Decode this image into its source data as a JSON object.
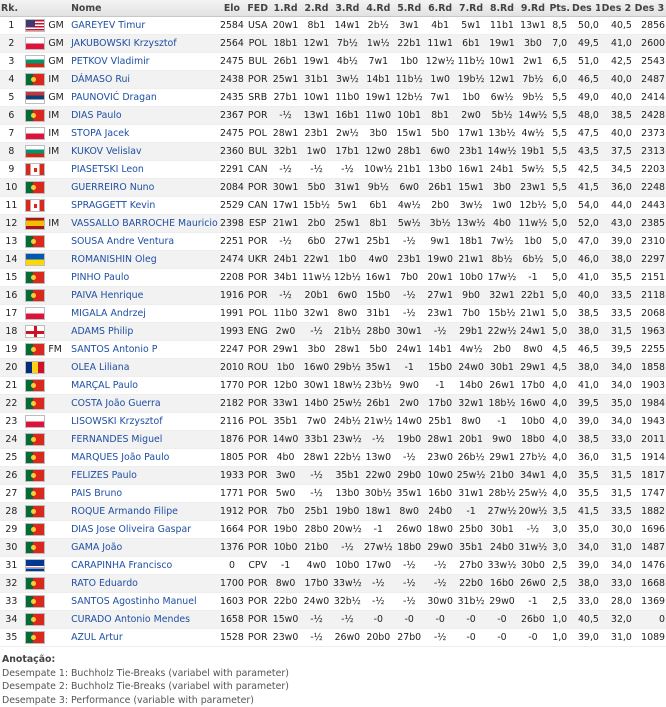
{
  "headers": {
    "rank": "Rk.",
    "title": "",
    "name": "Nome",
    "elo": "Elo",
    "fed": "FED",
    "rounds": [
      "1.Rd",
      "2.Rd",
      "3.Rd",
      "4.Rd",
      "5.Rd",
      "6.Rd",
      "7.Rd",
      "8.Rd",
      "9.Rd"
    ],
    "pts": "Pts.",
    "des1": "Des 1",
    "des2": "Des 2",
    "des3": "Des 3"
  },
  "rows": [
    {
      "rk": "1",
      "title": "GM",
      "name": "GAREYEV Timur",
      "elo": "2584",
      "fed": "USA",
      "flag": "usa",
      "rounds": [
        "20w1",
        "8b1",
        "14w1",
        "2b½",
        "3w1",
        "4b1",
        "5w1",
        "11b1",
        "13w1"
      ],
      "pts": "8,5",
      "des1": "50,0",
      "des2": "40,5",
      "des3": "2856"
    },
    {
      "rk": "2",
      "title": "GM",
      "name": "JAKUBOWSKI Krzysztof",
      "elo": "2564",
      "fed": "POL",
      "flag": "pol",
      "rounds": [
        "18b1",
        "12w1",
        "7b½",
        "1w½",
        "22b1",
        "11w1",
        "6b1",
        "19w1",
        "3b0"
      ],
      "pts": "7,0",
      "des1": "49,5",
      "des2": "41,0",
      "des3": "2600"
    },
    {
      "rk": "3",
      "title": "GM",
      "name": "PETKOV Vladimir",
      "elo": "2475",
      "fed": "BUL",
      "flag": "bul",
      "rounds": [
        "26b1",
        "19w1",
        "4b½",
        "7w1",
        "1b0",
        "12w½",
        "11b½",
        "10w1",
        "2w1"
      ],
      "pts": "6,5",
      "des1": "51,0",
      "des2": "42,5",
      "des3": "2543"
    },
    {
      "rk": "4",
      "title": "IM",
      "name": "DÁMASO Rui",
      "elo": "2438",
      "fed": "POR",
      "flag": "por",
      "rounds": [
        "25w1",
        "31b1",
        "3w½",
        "14b1",
        "11b½",
        "1w0",
        "19b½",
        "12w1",
        "7b½"
      ],
      "pts": "6,0",
      "des1": "46,5",
      "des2": "40,0",
      "des3": "2487"
    },
    {
      "rk": "5",
      "title": "GM",
      "name": "PAUNOVIĆ Dragan",
      "elo": "2435",
      "fed": "SRB",
      "flag": "srb",
      "rounds": [
        "27b1",
        "10w1",
        "11b0",
        "19w1",
        "12b½",
        "7w1",
        "1b0",
        "6w½",
        "9b½"
      ],
      "pts": "5,5",
      "des1": "49,0",
      "des2": "40,0",
      "des3": "2414"
    },
    {
      "rk": "6",
      "title": "IM",
      "name": "DIAS Paulo",
      "elo": "2367",
      "fed": "POR",
      "flag": "por",
      "rounds": [
        "-½",
        "13w1",
        "16b1",
        "11w0",
        "10b1",
        "8b1",
        "2w0",
        "5b½",
        "14w½"
      ],
      "pts": "5,5",
      "des1": "48,0",
      "des2": "38,5",
      "des3": "2428"
    },
    {
      "rk": "7",
      "title": "IM",
      "name": "STOPA Jacek",
      "elo": "2475",
      "fed": "POL",
      "flag": "pol",
      "rounds": [
        "28w1",
        "23b1",
        "2w½",
        "3b0",
        "15w1",
        "5b0",
        "17w1",
        "13b½",
        "4w½"
      ],
      "pts": "5,5",
      "des1": "47,5",
      "des2": "40,0",
      "des3": "2373"
    },
    {
      "rk": "8",
      "title": "IM",
      "name": "KUKOV Velislav",
      "elo": "2360",
      "fed": "BUL",
      "flag": "bul",
      "rounds": [
        "32b1",
        "1w0",
        "17b1",
        "12w0",
        "28b1",
        "6w0",
        "23b1",
        "14w½",
        "19b1"
      ],
      "pts": "5,5",
      "des1": "43,5",
      "des2": "37,5",
      "des3": "2313"
    },
    {
      "rk": "9",
      "title": "",
      "name": "PIASETSKI Leon",
      "elo": "2291",
      "fed": "CAN",
      "flag": "can",
      "rounds": [
        "-½",
        "-½",
        "-½",
        "10w½",
        "21b1",
        "13b0",
        "16w1",
        "24b1",
        "5w½"
      ],
      "pts": "5,5",
      "des1": "42,5",
      "des2": "34,5",
      "des3": "2203"
    },
    {
      "rk": "10",
      "title": "",
      "name": "GUERREIRO Nuno",
      "elo": "2084",
      "fed": "POR",
      "flag": "por",
      "rounds": [
        "30w1",
        "5b0",
        "31w1",
        "9b½",
        "6w0",
        "26b1",
        "15w1",
        "3b0",
        "23w1"
      ],
      "pts": "5,5",
      "des1": "41,5",
      "des2": "36,0",
      "des3": "2248"
    },
    {
      "rk": "11",
      "title": "",
      "name": "SPRAGGETT Kevin",
      "elo": "2529",
      "fed": "CAN",
      "flag": "can",
      "rounds": [
        "17w1",
        "15b½",
        "5w1",
        "6b1",
        "4w½",
        "2b0",
        "3w½",
        "1w0",
        "12b½"
      ],
      "pts": "5,0",
      "des1": "54,0",
      "des2": "44,0",
      "des3": "2443"
    },
    {
      "rk": "12",
      "title": "IM",
      "name": "VASSALLO BARROCHE Mauricio",
      "elo": "2398",
      "fed": "ESP",
      "flag": "esp",
      "rounds": [
        "21w1",
        "2b0",
        "25w1",
        "8b1",
        "5w½",
        "3b½",
        "13w½",
        "4b0",
        "11w½"
      ],
      "pts": "5,0",
      "des1": "52,0",
      "des2": "43,0",
      "des3": "2385"
    },
    {
      "rk": "13",
      "title": "",
      "name": "SOUSA Andre Ventura",
      "elo": "2251",
      "fed": "POR",
      "flag": "por",
      "rounds": [
        "-½",
        "6b0",
        "27w1",
        "25b1",
        "-½",
        "9w1",
        "18b1",
        "7w½",
        "1b0"
      ],
      "pts": "5,0",
      "des1": "47,0",
      "des2": "39,0",
      "des3": "2310"
    },
    {
      "rk": "14",
      "title": "",
      "name": "ROMANISHIN Oleg",
      "elo": "2474",
      "fed": "UKR",
      "flag": "ukr",
      "rounds": [
        "24b1",
        "22w1",
        "1b0",
        "4w0",
        "23b1",
        "19w0",
        "21w1",
        "8b½",
        "6b½"
      ],
      "pts": "5,0",
      "des1": "46,0",
      "des2": "38,0",
      "des3": "2297"
    },
    {
      "rk": "15",
      "title": "",
      "name": "PINHO Paulo",
      "elo": "2208",
      "fed": "POR",
      "flag": "por",
      "rounds": [
        "34b1",
        "11w½",
        "12b½",
        "16w1",
        "7b0",
        "20w1",
        "10b0",
        "17w½",
        "-1"
      ],
      "pts": "5,0",
      "des1": "41,0",
      "des2": "35,5",
      "des3": "2151"
    },
    {
      "rk": "16",
      "title": "",
      "name": "PAIVA Henrique",
      "elo": "1916",
      "fed": "POR",
      "flag": "por",
      "rounds": [
        "-½",
        "20b1",
        "6w0",
        "15b0",
        "-½",
        "27w1",
        "9b0",
        "32w1",
        "22b1"
      ],
      "pts": "5,0",
      "des1": "40,0",
      "des2": "33,5",
      "des3": "2118"
    },
    {
      "rk": "17",
      "title": "",
      "name": "MIGALA Andrzej",
      "elo": "1991",
      "fed": "POL",
      "flag": "pol",
      "rounds": [
        "11b0",
        "32w1",
        "8w0",
        "31b1",
        "-½",
        "23w1",
        "7b0",
        "15b½",
        "21w1"
      ],
      "pts": "5,0",
      "des1": "38,5",
      "des2": "33,5",
      "des3": "2068"
    },
    {
      "rk": "18",
      "title": "",
      "name": "ADAMS Philip",
      "elo": "1993",
      "fed": "ENG",
      "flag": "eng",
      "rounds": [
        "2w0",
        "-½",
        "21b½",
        "28b0",
        "30w1",
        "-½",
        "29b1",
        "22w½",
        "24w1"
      ],
      "pts": "5,0",
      "des1": "38,0",
      "des2": "31,5",
      "des3": "1963"
    },
    {
      "rk": "19",
      "title": "FM",
      "name": "SANTOS Antonio P",
      "elo": "2247",
      "fed": "POR",
      "flag": "por",
      "rounds": [
        "29w1",
        "3b0",
        "28w1",
        "5b0",
        "24w1",
        "14b1",
        "4w½",
        "2b0",
        "8w0"
      ],
      "pts": "4,5",
      "des1": "46,5",
      "des2": "39,5",
      "des3": "2255"
    },
    {
      "rk": "20",
      "title": "",
      "name": "OLEA Liliana",
      "elo": "2010",
      "fed": "ROU",
      "flag": "rou",
      "rounds": [
        "1b0",
        "16w0",
        "29b½",
        "35w1",
        "-1",
        "15b0",
        "24w0",
        "30b1",
        "29w1"
      ],
      "pts": "4,5",
      "des1": "38,0",
      "des2": "34,0",
      "des3": "1858"
    },
    {
      "rk": "21",
      "title": "",
      "name": "MARÇAL Paulo",
      "elo": "1770",
      "fed": "POR",
      "flag": "por",
      "rounds": [
        "12b0",
        "30w1",
        "18w½",
        "23b½",
        "9w0",
        "-1",
        "14b0",
        "26w1",
        "17b0"
      ],
      "pts": "4,0",
      "des1": "41,0",
      "des2": "34,0",
      "des3": "1903"
    },
    {
      "rk": "22",
      "title": "",
      "name": "COSTA João Guerra",
      "elo": "2182",
      "fed": "POR",
      "flag": "por",
      "rounds": [
        "33w1",
        "14b0",
        "25w½",
        "26b1",
        "2w0",
        "17b0",
        "32w1",
        "18b½",
        "16w0"
      ],
      "pts": "4,0",
      "des1": "39,5",
      "des2": "35,0",
      "des3": "1984"
    },
    {
      "rk": "23",
      "title": "",
      "name": "LISOWSKI Krzysztof",
      "elo": "2116",
      "fed": "POL",
      "flag": "pol",
      "rounds": [
        "35b1",
        "7w0",
        "24b½",
        "21w½",
        "14w0",
        "25b1",
        "8w0",
        "-1",
        "10b0"
      ],
      "pts": "4,0",
      "des1": "39,0",
      "des2": "34,0",
      "des3": "1943"
    },
    {
      "rk": "24",
      "title": "",
      "name": "FERNANDES Miguel",
      "elo": "1876",
      "fed": "POR",
      "flag": "por",
      "rounds": [
        "14w0",
        "33b1",
        "23w½",
        "-½",
        "19b0",
        "28w1",
        "20b1",
        "9w0",
        "18b0"
      ],
      "pts": "4,0",
      "des1": "38,5",
      "des2": "33,0",
      "des3": "2011"
    },
    {
      "rk": "25",
      "title": "",
      "name": "MARQUES João Paulo",
      "elo": "1805",
      "fed": "POR",
      "flag": "por",
      "rounds": [
        "4b0",
        "28w1",
        "22b½",
        "13w0",
        "-½",
        "23w0",
        "26b½",
        "29w1",
        "27b½"
      ],
      "pts": "4,0",
      "des1": "36,0",
      "des2": "31,5",
      "des3": "1914"
    },
    {
      "rk": "26",
      "title": "",
      "name": "FELIZES Paulo",
      "elo": "1933",
      "fed": "POR",
      "flag": "por",
      "rounds": [
        "3w0",
        "-½",
        "35b1",
        "22w0",
        "29b0",
        "10w0",
        "25w½",
        "21b0",
        "34w1"
      ],
      "pts": "4,0",
      "des1": "35,5",
      "des2": "31,5",
      "des3": "1817"
    },
    {
      "rk": "27",
      "title": "",
      "name": "PAIS Bruno",
      "elo": "1771",
      "fed": "POR",
      "flag": "por",
      "rounds": [
        "5w0",
        "-½",
        "13b0",
        "30b½",
        "35w1",
        "16b0",
        "31w1",
        "28b½",
        "25w½"
      ],
      "pts": "4,0",
      "des1": "35,5",
      "des2": "31,5",
      "des3": "1747"
    },
    {
      "rk": "28",
      "title": "",
      "name": "ROQUE Armando Filipe",
      "elo": "1912",
      "fed": "POR",
      "flag": "por",
      "rounds": [
        "7b0",
        "25b1",
        "19b0",
        "18w1",
        "8w0",
        "24b0",
        "-1",
        "27w½",
        "20w½"
      ],
      "pts": "3,5",
      "des1": "41,5",
      "des2": "33,5",
      "des3": "1882"
    },
    {
      "rk": "29",
      "title": "",
      "name": "DIAS Jose Oliveira Gaspar",
      "elo": "1664",
      "fed": "POR",
      "flag": "por",
      "rounds": [
        "19b0",
        "28b0",
        "20w½",
        "-1",
        "26w0",
        "18w0",
        "25b0",
        "30b1",
        "-½"
      ],
      "pts": "3,0",
      "des1": "35,0",
      "des2": "30,0",
      "des3": "1696"
    },
    {
      "rk": "30",
      "title": "",
      "name": "GAMA João",
      "elo": "1376",
      "fed": "POR",
      "flag": "por",
      "rounds": [
        "10b0",
        "21b0",
        "-½",
        "27w½",
        "18b0",
        "29w0",
        "35b1",
        "24b0",
        "31w½"
      ],
      "pts": "3,0",
      "des1": "34,0",
      "des2": "31,0",
      "des3": "1487"
    },
    {
      "rk": "31",
      "title": "",
      "name": "CARAPINHA Francisco",
      "elo": "0",
      "fed": "CPV",
      "flag": "cpv",
      "rounds": [
        "-1",
        "4w0",
        "10b0",
        "17w0",
        "-½",
        "-½",
        "27b0",
        "33w½",
        "30b0"
      ],
      "pts": "2,5",
      "des1": "39,0",
      "des2": "34,0",
      "des3": "1476"
    },
    {
      "rk": "32",
      "title": "",
      "name": "RATO Eduardo",
      "elo": "1700",
      "fed": "POR",
      "flag": "por",
      "rounds": [
        "8w0",
        "17b0",
        "33w½",
        "-½",
        "-½",
        "-½",
        "22b0",
        "16b0",
        "26w0"
      ],
      "pts": "2,5",
      "des1": "38,0",
      "des2": "33,0",
      "des3": "1668"
    },
    {
      "rk": "33",
      "title": "",
      "name": "SANTOS Agostinho Manuel",
      "elo": "1603",
      "fed": "POR",
      "flag": "por",
      "rounds": [
        "22b0",
        "24w0",
        "32b½",
        "-½",
        "-½",
        "30w0",
        "31b½",
        "29w0",
        "-1"
      ],
      "pts": "2,5",
      "des1": "33,0",
      "des2": "28,0",
      "des3": "1369"
    },
    {
      "rk": "34",
      "title": "",
      "name": "CURADO Antonio Mendes",
      "elo": "1658",
      "fed": "POR",
      "flag": "por",
      "rounds": [
        "15w0",
        "-½",
        "-½",
        "-0",
        "-0",
        "-0",
        "-0",
        "-0",
        "26b0"
      ],
      "pts": "1,0",
      "des1": "40,5",
      "des2": "32,0",
      "des3": "0"
    },
    {
      "rk": "35",
      "title": "",
      "name": "AZUL Artur",
      "elo": "1528",
      "fed": "POR",
      "flag": "por",
      "rounds": [
        "23w0",
        "-½",
        "26w0",
        "20b0",
        "27b0",
        "-½",
        "-0",
        "-0",
        "-0"
      ],
      "pts": "1,0",
      "des1": "39,0",
      "des2": "31,0",
      "des3": "1089"
    }
  ],
  "notes": {
    "title": "Anotação:",
    "lines": [
      "Desempate 1: Buchholz Tie-Breaks (variabel with parameter)",
      "Desempate 2: Buchholz Tie-Breaks (variabel with parameter)",
      "Desempate 3: Performance (variable with parameter)"
    ]
  }
}
